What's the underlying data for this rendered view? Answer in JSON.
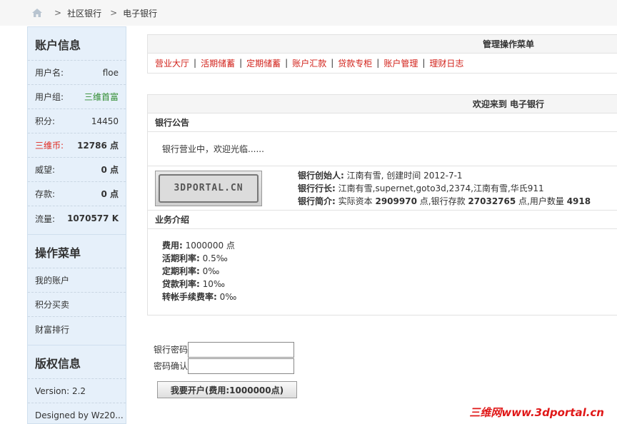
{
  "breadcrumb": {
    "separator": ">",
    "items": [
      "社区银行",
      "电子银行"
    ]
  },
  "sidebar": {
    "account_title": "账户信息",
    "account_rows": [
      {
        "label": "用户名:",
        "value": "floe"
      },
      {
        "label": "用户组:",
        "value": "三维首富"
      },
      {
        "label": "积分:",
        "value": "14450"
      },
      {
        "label": "三维币:",
        "value": "12786 点"
      },
      {
        "label": "威望:",
        "value": "0 点"
      },
      {
        "label": "存款:",
        "value": "0 点"
      },
      {
        "label": "流量:",
        "value": "1070577 K"
      }
    ],
    "menu_title": "操作菜单",
    "menu_items": [
      "我的账户",
      "积分买卖",
      "财富排行"
    ],
    "copyright_title": "版权信息",
    "version": "Version: 2.2",
    "designed_by": "Designed by Wz20..."
  },
  "admin_panel": {
    "title": "管理操作菜单",
    "menu": [
      "营业大厅",
      "活期储蓄",
      "定期储蓄",
      "账户汇款",
      "贷款专柜",
      "账户管理",
      "理财日志"
    ],
    "separator": "|"
  },
  "welcome_panel": {
    "title": "欢迎来到 电子银行",
    "notice_title": "银行公告",
    "notice_text": "银行营业中，欢迎光临......",
    "logo_text": "3DPORTAL.CN",
    "founder_label": "银行创始人:",
    "founder_value": "江南有雪, 创建时间 2012-7-1",
    "manager_label": "银行行长:",
    "manager_value": "江南有雪,supernet,goto3d,2374,江南有雪,华氏911",
    "intro_label": "银行简介:",
    "intro_prefix": "实际资本",
    "intro_capital": "2909970",
    "intro_mid": "点,银行存款",
    "intro_deposit": "27032765",
    "intro_mid2": "点,用户数量",
    "intro_users": "4918",
    "services_title": "业务介绍",
    "services": [
      {
        "label": "费用:",
        "value": "1000000 点"
      },
      {
        "label": "活期利率:",
        "value": "0.5‰"
      },
      {
        "label": "定期利率:",
        "value": "0‰"
      },
      {
        "label": "贷款利率:",
        "value": "10‰"
      },
      {
        "label": "转帐手续费率:",
        "value": "0‰"
      }
    ]
  },
  "form": {
    "password_label": "银行密码",
    "confirm_label": "密码确认",
    "password_value": "",
    "confirm_value": "",
    "submit_label": "我要开户(费用:1000000点)"
  },
  "watermark": "三维网www.3dportal.cn"
}
